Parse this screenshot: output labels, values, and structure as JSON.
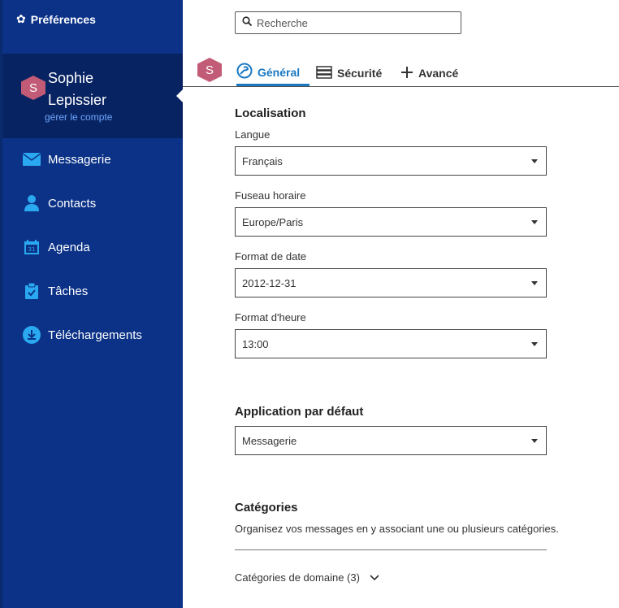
{
  "sidebar": {
    "title": "Préférences",
    "account": {
      "avatar_initial": "S",
      "name": "Sophie Lepissier",
      "manage_link": "gérer le compte"
    },
    "nav": [
      {
        "label": "Messagerie",
        "icon": "mail-icon"
      },
      {
        "label": "Contacts",
        "icon": "person-icon"
      },
      {
        "label": "Agenda",
        "icon": "calendar-icon"
      },
      {
        "label": "Tâches",
        "icon": "clipboard-icon"
      },
      {
        "label": "Téléchargements",
        "icon": "download-icon"
      }
    ]
  },
  "search": {
    "placeholder": "Recherche"
  },
  "tabs": {
    "avatar_initial": "S",
    "items": [
      {
        "label": "Général",
        "icon": "general-icon",
        "active": true
      },
      {
        "label": "Sécurité",
        "icon": "security-icon",
        "active": false
      },
      {
        "label": "Avancé",
        "icon": "plus-icon",
        "active": false
      }
    ]
  },
  "localisation": {
    "title": "Localisation",
    "fields": [
      {
        "label": "Langue",
        "value": "Français"
      },
      {
        "label": "Fuseau horaire",
        "value": "Europe/Paris"
      },
      {
        "label": "Format de date",
        "value": "2012-12-31"
      },
      {
        "label": "Format d'heure",
        "value": "13:00"
      }
    ]
  },
  "default_app": {
    "title": "Application par défaut",
    "value": "Messagerie"
  },
  "categories": {
    "title": "Catégories",
    "description": "Organisez vos messages en y associant une ou plusieurs catégories.",
    "domain_label": "Catégories de domaine (3)"
  },
  "colors": {
    "sidebar_bg": "#0b3287",
    "accent": "#1a78c2",
    "avatar": "#c25b76",
    "nav_icon": "#2aa9f0"
  }
}
